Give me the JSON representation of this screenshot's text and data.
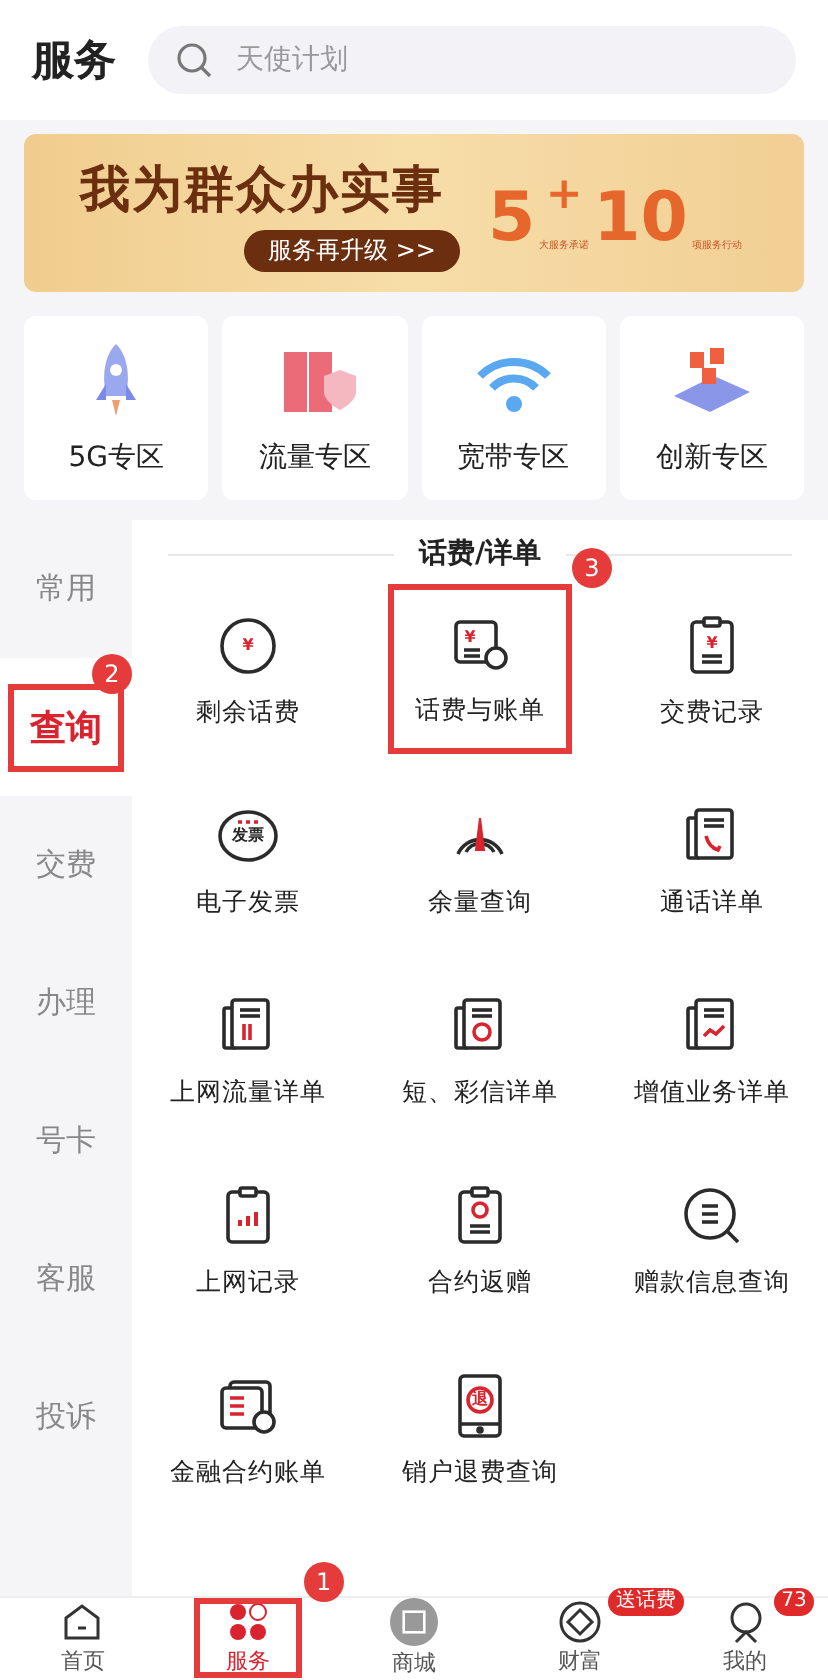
{
  "header": {
    "title": "服务",
    "search": {
      "placeholder": "天使计划"
    }
  },
  "banner": {
    "headline": "我为群众办实事",
    "button": "服务再升级 >>",
    "number_a": "5",
    "plus": "+",
    "number_b": "10",
    "note_a": "大服务承诺",
    "note_b": "项服务行动"
  },
  "zones": [
    {
      "label": "5G专区"
    },
    {
      "label": "流量专区"
    },
    {
      "label": "宽带专区"
    },
    {
      "label": "创新专区"
    }
  ],
  "sidebar": {
    "items": [
      {
        "label": "常用",
        "selected": false
      },
      {
        "label": "查询",
        "selected": true,
        "callout": "2"
      },
      {
        "label": "交费",
        "selected": false
      },
      {
        "label": "办理",
        "selected": false
      },
      {
        "label": "号卡",
        "selected": false
      },
      {
        "label": "客服",
        "selected": false
      },
      {
        "label": "投诉",
        "selected": false
      }
    ]
  },
  "section": {
    "title": "话费/详单",
    "items": [
      {
        "label": "剩余话费",
        "icon_text": "¥"
      },
      {
        "label": "话费与账单",
        "callout": "3",
        "icon_text": "¥"
      },
      {
        "label": "交费记录",
        "icon_text": "¥"
      },
      {
        "label": "电子发票",
        "icon_text": "发票"
      },
      {
        "label": "余量查询"
      },
      {
        "label": "通话详单"
      },
      {
        "label": "上网流量详单"
      },
      {
        "label": "短、彩信详单"
      },
      {
        "label": "增值业务详单"
      },
      {
        "label": "上网记录"
      },
      {
        "label": "合约返赠"
      },
      {
        "label": "赠款信息查询"
      },
      {
        "label": "金融合约账单"
      },
      {
        "label": "销户退费查询",
        "icon_text": "退"
      }
    ]
  },
  "bottom_nav": [
    {
      "label": "首页",
      "selected": false
    },
    {
      "label": "服务",
      "selected": true,
      "callout": "1"
    },
    {
      "label": "商城",
      "selected": false
    },
    {
      "label": "财富",
      "selected": false,
      "badge": "送话费"
    },
    {
      "label": "我的",
      "selected": false,
      "badge": "73"
    }
  ]
}
